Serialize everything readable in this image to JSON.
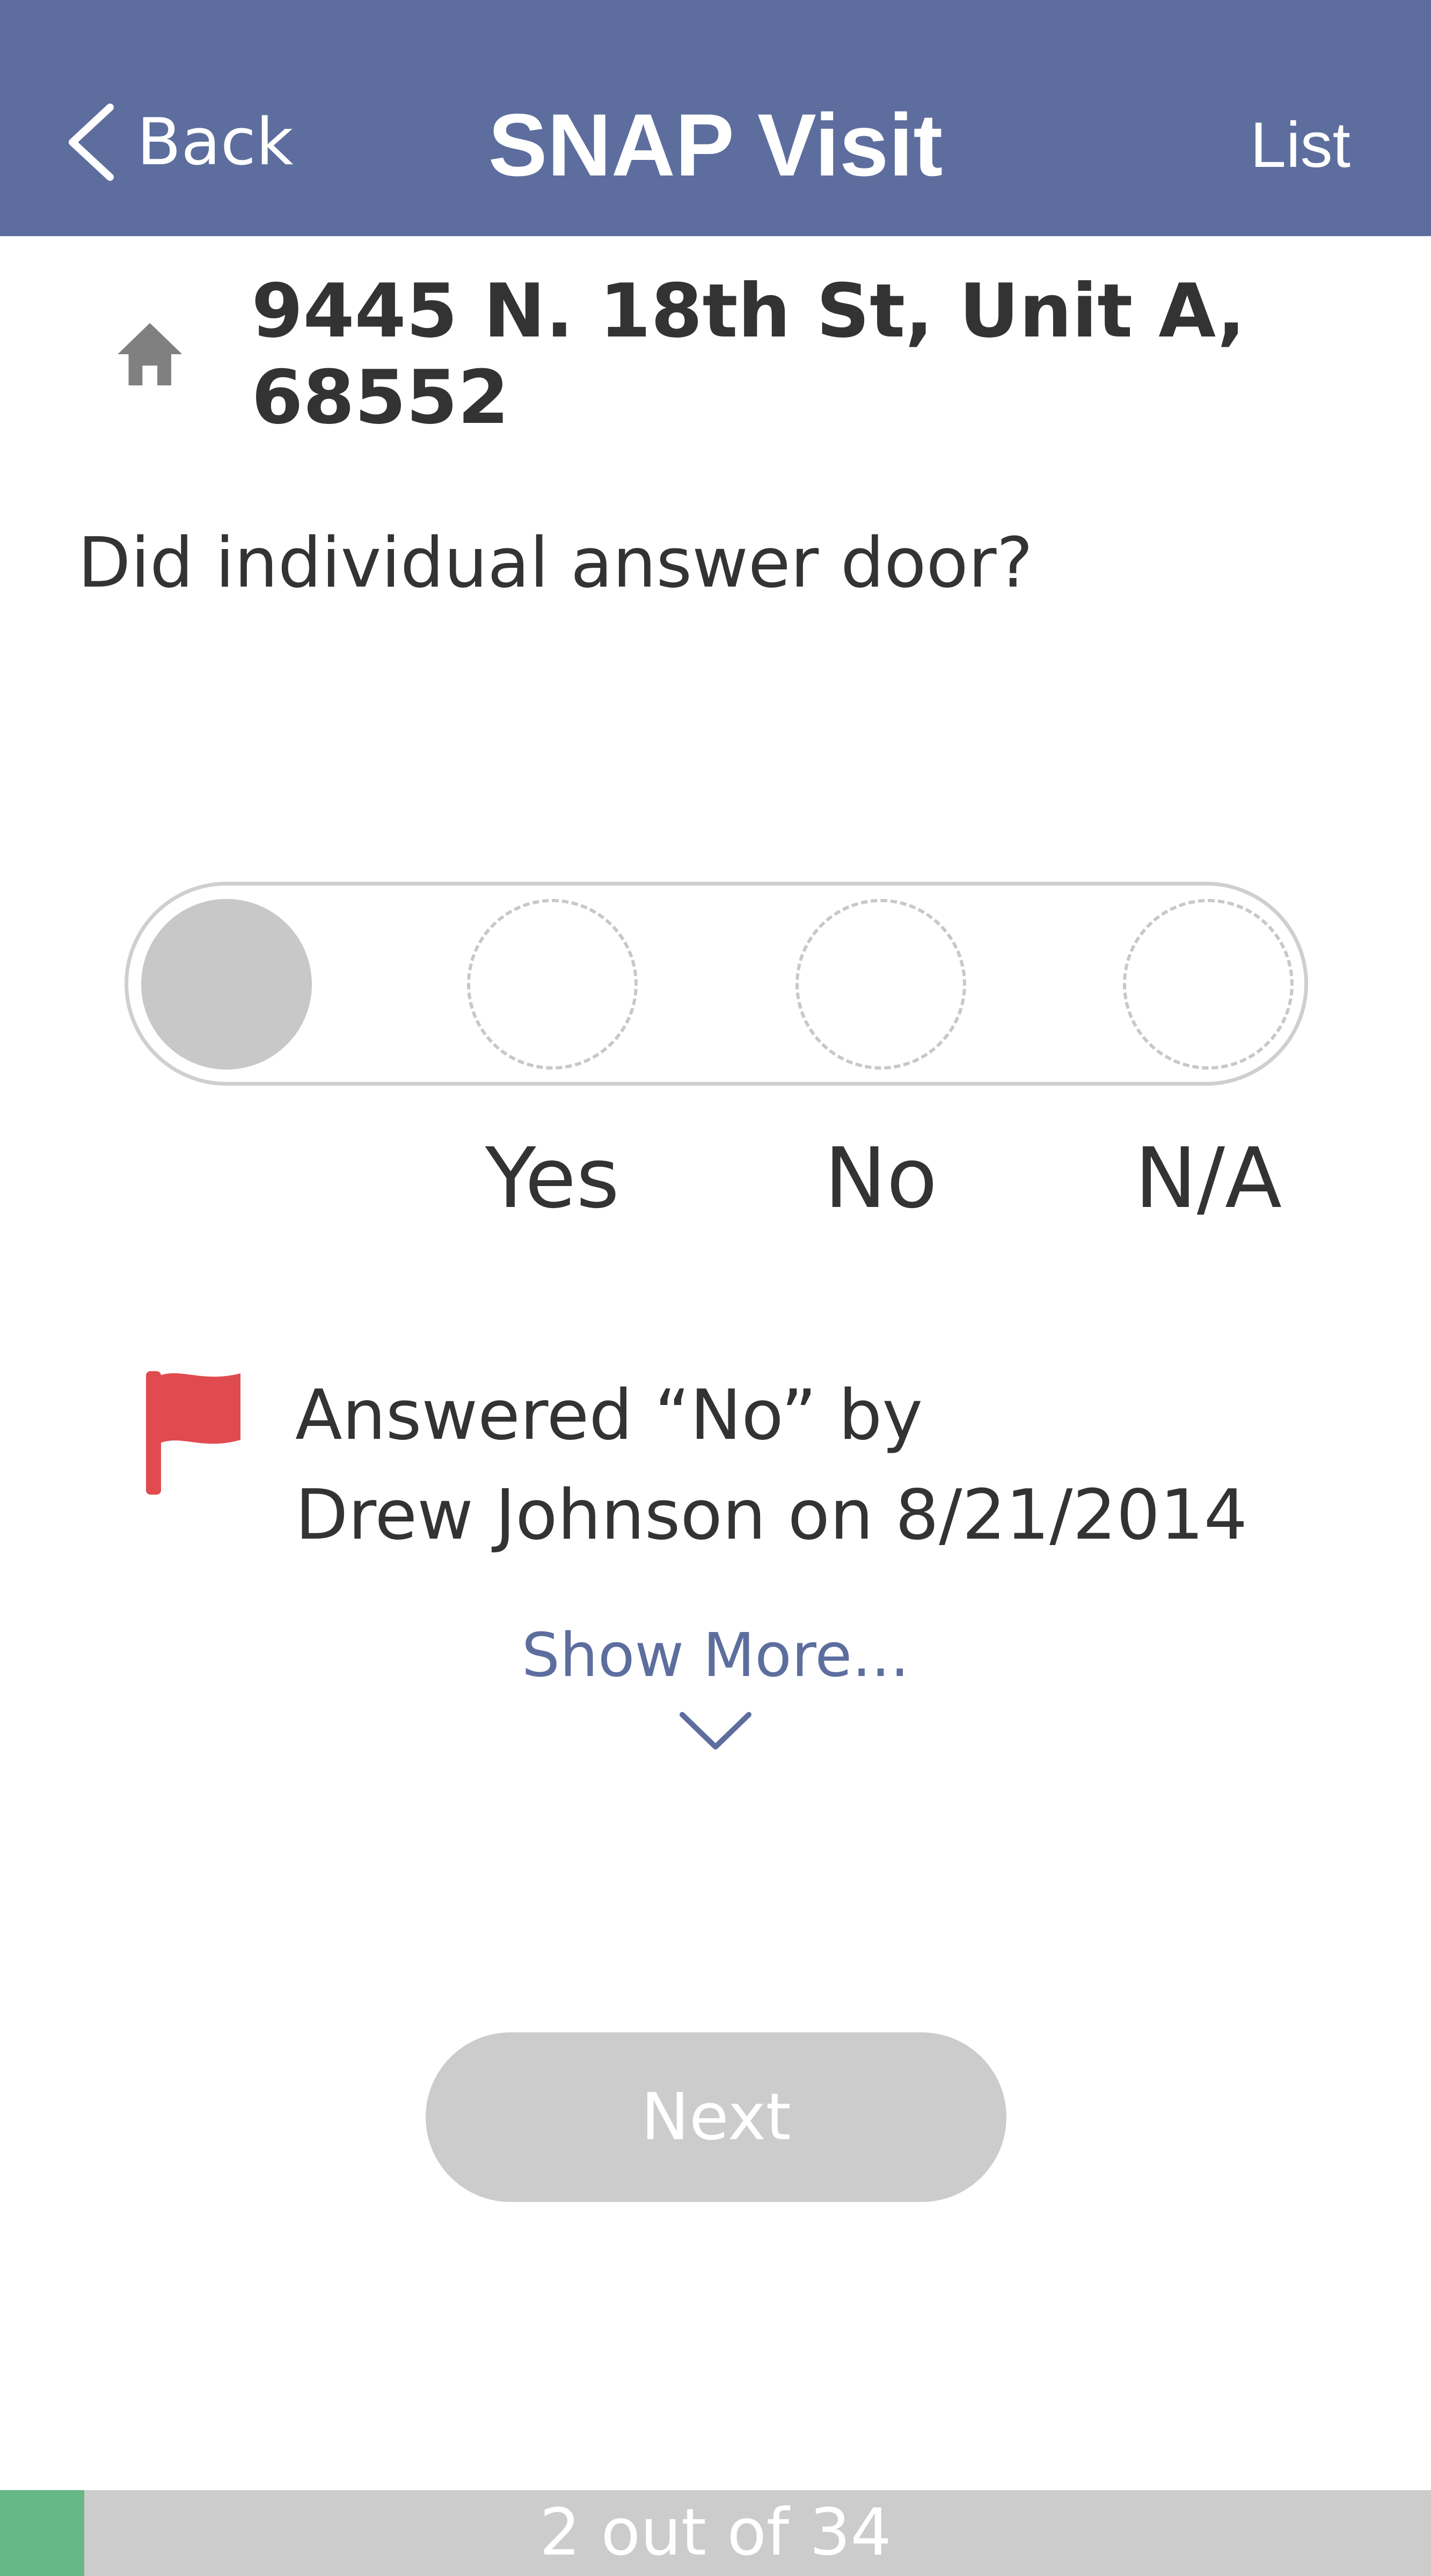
{
  "header": {
    "back_label": "Back",
    "title": "SNAP Visit",
    "list_label": "List",
    "back_icon": "chevron-left-icon",
    "background_color": "#5d6e9e"
  },
  "address": {
    "icon": "home-icon",
    "text": "9445 N. 18th St, Unit A, 68552"
  },
  "question": {
    "text": "Did individual answer door?",
    "options": [
      "Yes",
      "No",
      "N/A"
    ],
    "selected": null
  },
  "history": {
    "icon": "flag-icon",
    "flag_color": "#e04b4f",
    "line1": "Answered “No” by",
    "line2": "Drew Johnson on 8/21/2014"
  },
  "show_more": {
    "label": "Show More...",
    "icon": "chevron-down-icon",
    "color": "#5d6e9e"
  },
  "next_button": {
    "label": "Next",
    "disabled": true
  },
  "progress": {
    "text": "2 out of 34",
    "current": 2,
    "total": 34,
    "fill_color": "#66b884"
  }
}
